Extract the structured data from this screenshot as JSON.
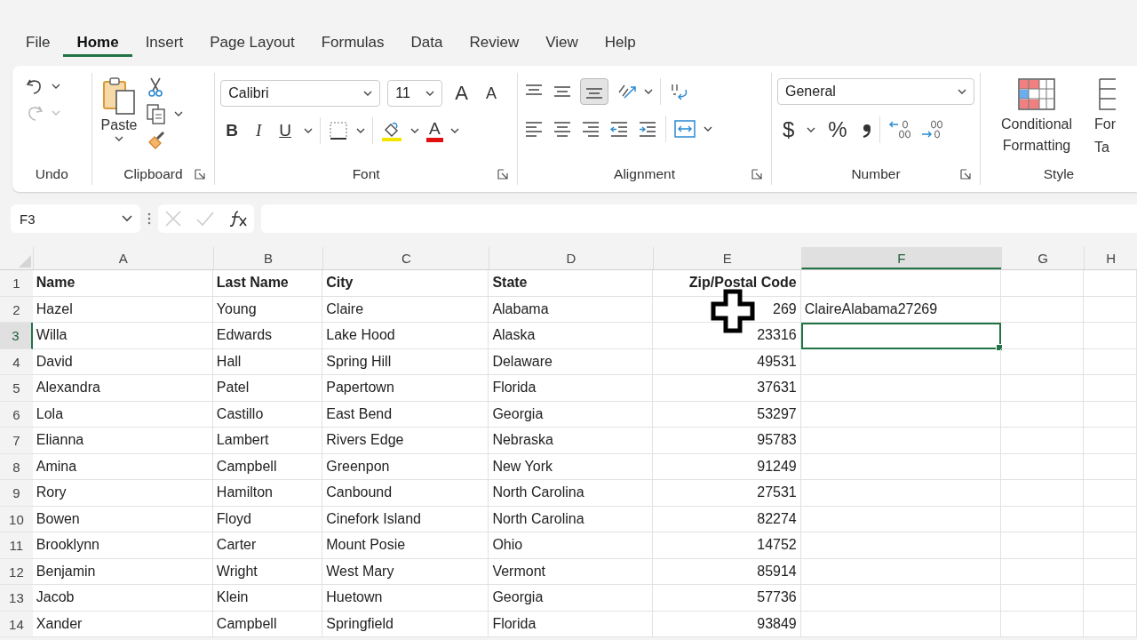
{
  "tabs": [
    {
      "label": "File",
      "selected": false
    },
    {
      "label": "Home",
      "selected": true
    },
    {
      "label": "Insert",
      "selected": false
    },
    {
      "label": "Page Layout",
      "selected": false
    },
    {
      "label": "Formulas",
      "selected": false
    },
    {
      "label": "Data",
      "selected": false
    },
    {
      "label": "Review",
      "selected": false
    },
    {
      "label": "View",
      "selected": false
    },
    {
      "label": "Help",
      "selected": false
    }
  ],
  "ribbon": {
    "groups": [
      {
        "kind": "undo",
        "label": "Undo",
        "launcher": false
      },
      {
        "kind": "clipboard",
        "label": "Clipboard",
        "launcher": true
      },
      {
        "kind": "font",
        "label": "Font",
        "launcher": true
      },
      {
        "kind": "alignment",
        "label": "Alignment",
        "launcher": true
      },
      {
        "kind": "number",
        "label": "Number",
        "launcher": true
      },
      {
        "kind": "styles",
        "label": "Style",
        "launcher": false
      }
    ],
    "paste_label": "Paste",
    "font_name": "Calibri",
    "font_size": "11",
    "grow_glyph": "A",
    "shrink_glyph": "A",
    "bold_glyph": "B",
    "italic_glyph": "I",
    "underline_glyph": "U",
    "font_color_glyph": "A",
    "number_format": "General",
    "currency_glyph": "$",
    "percent_glyph": "%",
    "conditional_label": "Conditional Formatting",
    "format_table_lines": [
      "For",
      "Ta"
    ]
  },
  "formula_bar": {
    "name_box": "F3"
  },
  "columns": [
    {
      "label": "A",
      "selected": false
    },
    {
      "label": "B",
      "selected": false
    },
    {
      "label": "C",
      "selected": false
    },
    {
      "label": "D",
      "selected": false
    },
    {
      "label": "E",
      "selected": false
    },
    {
      "label": "F",
      "selected": true
    },
    {
      "label": "G",
      "selected": false
    },
    {
      "label": "H",
      "selected": false
    }
  ],
  "rows": [
    {
      "number": "1",
      "selected": false,
      "bold": true,
      "cells": [
        "Name",
        "Last Name",
        "City",
        "State",
        "Zip/Postal Code"
      ]
    },
    {
      "number": "2",
      "selected": false,
      "bold": false,
      "cells": [
        "Hazel",
        "Young",
        "Claire",
        "Alabama",
        "269",
        "ClaireAlabama27269"
      ]
    },
    {
      "number": "3",
      "selected": true,
      "bold": false,
      "cells": [
        "Willa",
        "Edwards",
        "Lake Hood",
        "Alaska",
        "23316"
      ]
    },
    {
      "number": "4",
      "selected": false,
      "bold": false,
      "cells": [
        "David",
        "Hall",
        "Spring Hill",
        "Delaware",
        "49531"
      ]
    },
    {
      "number": "5",
      "selected": false,
      "bold": false,
      "cells": [
        "Alexandra",
        "Patel",
        "Papertown",
        "Florida",
        "37631"
      ]
    },
    {
      "number": "6",
      "selected": false,
      "bold": false,
      "cells": [
        "Lola",
        "Castillo",
        "East Bend",
        "Georgia",
        "53297"
      ]
    },
    {
      "number": "7",
      "selected": false,
      "bold": false,
      "cells": [
        "Elianna",
        "Lambert",
        "Rivers Edge",
        "Nebraska",
        "95783"
      ]
    },
    {
      "number": "8",
      "selected": false,
      "bold": false,
      "cells": [
        "Amina",
        "Campbell",
        "Greenpon",
        "New York",
        "91249"
      ]
    },
    {
      "number": "9",
      "selected": false,
      "bold": false,
      "cells": [
        "Rory",
        "Hamilton",
        "Canbound",
        "North Carolina",
        "27531"
      ]
    },
    {
      "number": "10",
      "selected": false,
      "bold": false,
      "cells": [
        "Bowen",
        "Floyd",
        "Cinefork Island",
        "North Carolina",
        "82274"
      ]
    },
    {
      "number": "11",
      "selected": false,
      "bold": false,
      "cells": [
        "Brooklynn",
        "Carter",
        "Mount Posie",
        "Ohio",
        "14752"
      ]
    },
    {
      "number": "12",
      "selected": false,
      "bold": false,
      "cells": [
        "Benjamin",
        "Wright",
        "West Mary",
        "Vermont",
        "85914"
      ]
    },
    {
      "number": "13",
      "selected": false,
      "bold": false,
      "cells": [
        "Jacob",
        "Klein",
        "Huetown",
        "Georgia",
        "57736"
      ]
    },
    {
      "number": "14",
      "selected": false,
      "bold": false,
      "cells": [
        "Xander",
        "Campbell",
        "Springfield",
        "Florida",
        "93849"
      ]
    }
  ]
}
